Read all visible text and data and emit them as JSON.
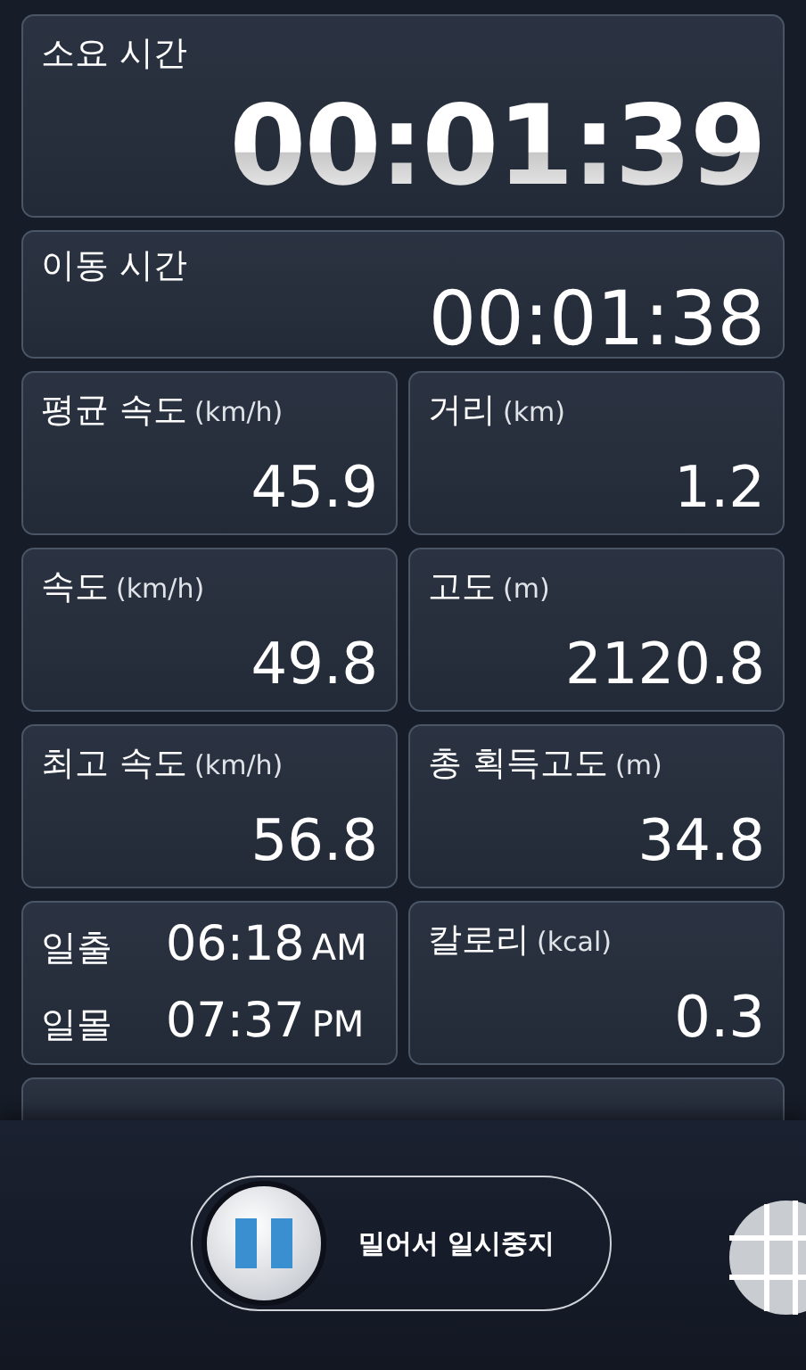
{
  "timers": [
    {
      "label": "소요 시간",
      "value": "00:01:39",
      "kind": "large"
    },
    {
      "label": "이동 시간",
      "value": "00:01:38",
      "kind": "medium"
    }
  ],
  "stats": [
    {
      "kind": "stat",
      "label": "평균 속도",
      "unit": "(km/h)",
      "value": "45.9"
    },
    {
      "kind": "stat",
      "label": "거리",
      "unit": "(km)",
      "value": "1.2"
    },
    {
      "kind": "stat",
      "label": "속도",
      "unit": "(km/h)",
      "value": "49.8"
    },
    {
      "kind": "stat",
      "label": "고도",
      "unit": "(m)",
      "value": "2120.8"
    },
    {
      "kind": "stat",
      "label": "최고 속도",
      "unit": "(km/h)",
      "value": "56.8"
    },
    {
      "kind": "stat",
      "label": "총 획득고도",
      "unit": "(m)",
      "value": "34.8"
    },
    {
      "kind": "sun",
      "rows": [
        {
          "label": "일출",
          "time": "06:18",
          "period": "AM"
        },
        {
          "label": "일몰",
          "time": "07:37",
          "period": "PM"
        }
      ]
    },
    {
      "kind": "stat",
      "label": "칼로리",
      "unit": "(kcal)",
      "value": "0.3"
    }
  ],
  "pause_slider": {
    "label": "밀어서 일시중지",
    "level": 0
  }
}
